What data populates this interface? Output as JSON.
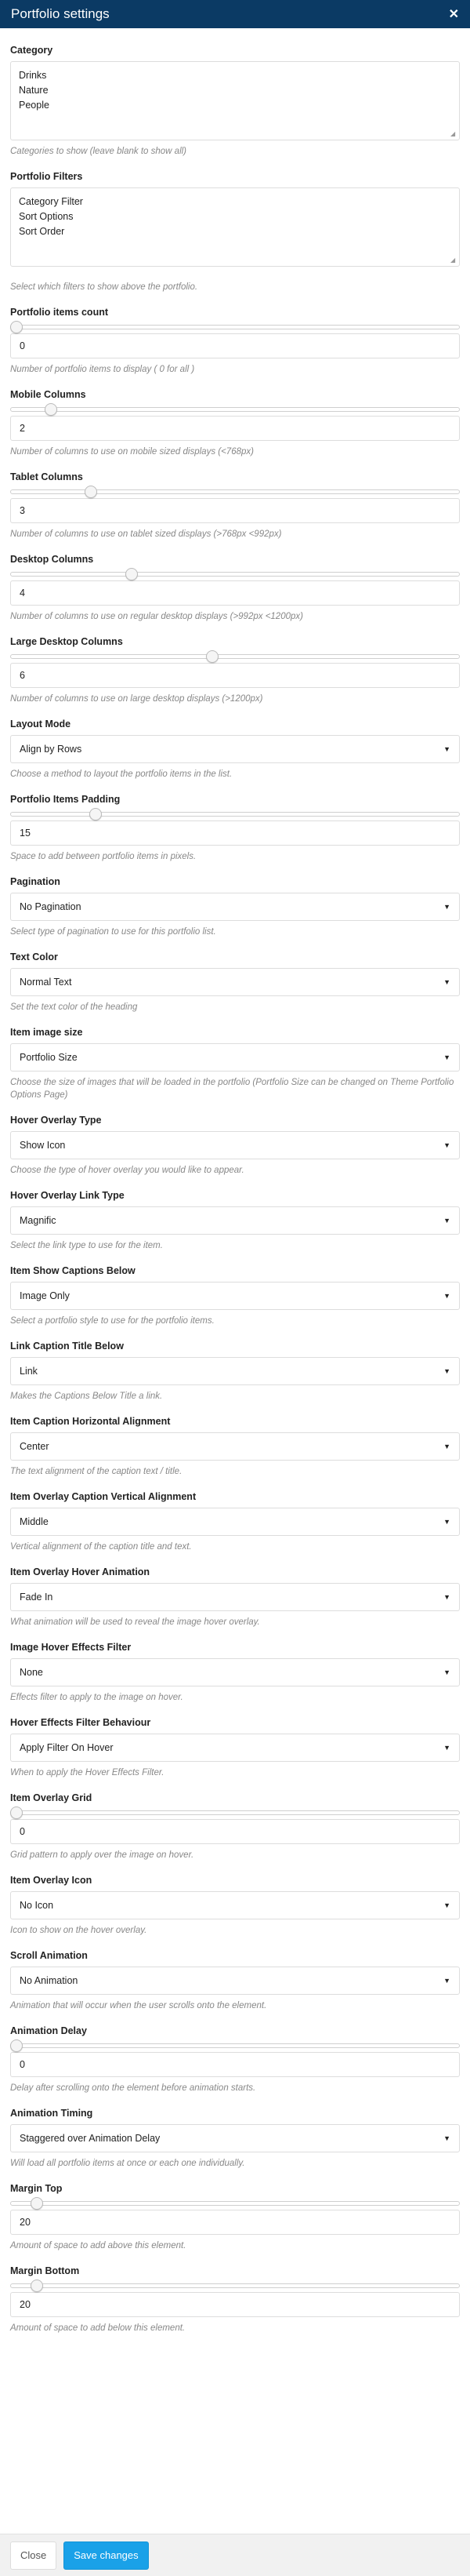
{
  "dialog": {
    "title": "Portfolio settings",
    "close_glyph": "✕"
  },
  "fields": {
    "category": {
      "label": "Category",
      "items": [
        "Drinks",
        "Nature",
        "People"
      ],
      "help": "Categories to show (leave blank to show all)"
    },
    "filters": {
      "label": "Portfolio Filters",
      "items": [
        "Category Filter",
        "Sort Options",
        "Sort Order"
      ],
      "help": "Select which filters to show above the portfolio."
    },
    "items_count": {
      "label": "Portfolio items count",
      "value": "0",
      "slider_level": 0,
      "help": "Number of portfolio items to display ( 0 for all )"
    },
    "mobile_columns": {
      "label": "Mobile Columns",
      "value": "2",
      "slider_level": 0.09,
      "help": "Number of columns to use on mobile sized displays (<768px)"
    },
    "tablet_columns": {
      "label": "Tablet Columns",
      "value": "3",
      "slider_level": 0.18,
      "help": "Number of columns to use on tablet sized displays (>768px <992px)"
    },
    "desktop_columns": {
      "label": "Desktop Columns",
      "value": "4",
      "slider_level": 0.27,
      "help": "Number of columns to use on regular desktop displays (>992px <1200px)"
    },
    "large_desktop_columns": {
      "label": "Large Desktop Columns",
      "value": "6",
      "slider_level": 0.45,
      "help": "Number of columns to use on large desktop displays (>1200px)"
    },
    "layout_mode": {
      "label": "Layout Mode",
      "value": "Align by Rows",
      "help": "Choose a method to layout the portfolio items in the list."
    },
    "items_padding": {
      "label": "Portfolio Items Padding",
      "value": "15",
      "slider_level": 0.19,
      "help": "Space to add between portfolio items in pixels."
    },
    "pagination": {
      "label": "Pagination",
      "value": "No Pagination",
      "help": "Select type of pagination to use for this portfolio list."
    },
    "text_color": {
      "label": "Text Color",
      "value": "Normal Text",
      "help": "Set the text color of the heading"
    },
    "image_size": {
      "label": "Item image size",
      "value": "Portfolio Size",
      "help": "Choose the size of images that will be loaded in the portfolio (Portfolio Size can be changed on Theme Portfolio Options Page)"
    },
    "hover_overlay_type": {
      "label": "Hover Overlay Type",
      "value": "Show Icon",
      "help": "Choose the type of hover overlay you would like to appear."
    },
    "hover_link_type": {
      "label": "Hover Overlay Link Type",
      "value": "Magnific",
      "help": "Select the link type to use for the item."
    },
    "captions_below": {
      "label": "Item Show Captions Below",
      "value": "Image Only",
      "help": "Select a portfolio style to use for the portfolio items."
    },
    "caption_title_below": {
      "label": "Link Caption Title Below",
      "value": "Link",
      "help": "Makes the Captions Below Title a link."
    },
    "caption_h_align": {
      "label": "Item Caption Horizontal Alignment",
      "value": "Center",
      "help": "The text alignment of the caption text / title."
    },
    "caption_v_align": {
      "label": "Item Overlay Caption Vertical Alignment",
      "value": "Middle",
      "help": "Vertical alignment of the caption title and text."
    },
    "hover_animation": {
      "label": "Item Overlay Hover Animation",
      "value": "Fade In",
      "help": "What animation will be used to reveal the image hover overlay."
    },
    "hover_effects_filter": {
      "label": "Image Hover Effects Filter",
      "value": "None",
      "help": "Effects filter to apply to the image on hover."
    },
    "filter_behaviour": {
      "label": "Hover Effects Filter Behaviour",
      "value": "Apply Filter On Hover",
      "help": "When to apply the Hover Effects Filter."
    },
    "overlay_grid": {
      "label": "Item Overlay Grid",
      "value": "0",
      "slider_level": 0,
      "help": "Grid pattern to apply over the image on hover."
    },
    "overlay_icon": {
      "label": "Item Overlay Icon",
      "value": "No Icon",
      "help": "Icon to show on the hover overlay."
    },
    "scroll_animation": {
      "label": "Scroll Animation",
      "value": "No Animation",
      "help": "Animation that will occur when the user scrolls onto the element."
    },
    "animation_delay": {
      "label": "Animation Delay",
      "value": "0",
      "slider_level": 0,
      "help": "Delay after scrolling onto the element before animation starts."
    },
    "animation_timing": {
      "label": "Animation Timing",
      "value": "Staggered over Animation Delay",
      "help": "Will load all portfolio items at once or each one individually."
    },
    "margin_top": {
      "label": "Margin Top",
      "value": "20",
      "slider_level": 0.06,
      "help": "Amount of space to add above this element."
    },
    "margin_bottom": {
      "label": "Margin Bottom",
      "value": "20",
      "slider_level": 0.06,
      "help": "Amount of space to add below this element."
    }
  },
  "footer": {
    "close_label": "Close",
    "save_label": "Save changes"
  },
  "icons": {
    "select_arrow": "▼",
    "resize_handle": "◢"
  },
  "colors": {
    "titlebar": "#0b3a64",
    "primary_button": "#1aa1e8",
    "help_text": "#888888"
  }
}
